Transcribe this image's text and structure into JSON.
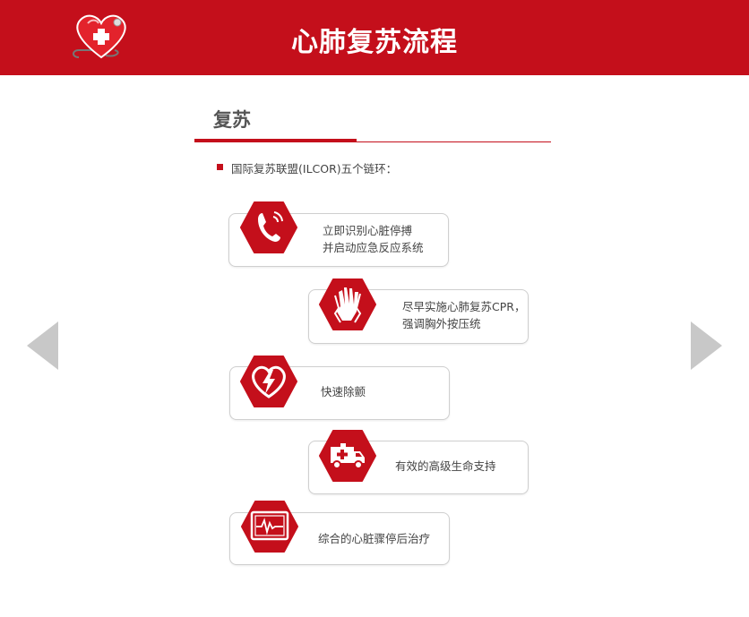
{
  "header": {
    "title": "心肺复苏流程"
  },
  "section": {
    "title": "复苏",
    "intro": "国际复苏联盟(ILCOR)五个链环："
  },
  "steps": [
    {
      "icon": "phone-icon",
      "line1": "立即识别心脏停搏",
      "line2": "并启动应急反应系统"
    },
    {
      "icon": "hands-icon",
      "line1": "尽早实施心肺复苏CPR，",
      "line2": "强调胸外按压统"
    },
    {
      "icon": "defibrillator-heart-icon",
      "line1": "快速除颤",
      "line2": ""
    },
    {
      "icon": "ambulance-icon",
      "line1": "有效的高级生命支持",
      "line2": ""
    },
    {
      "icon": "heart-monitor-icon",
      "line1": "综合的心脏骤停后治疗",
      "line2": ""
    }
  ],
  "colors": {
    "accent": "#c40f1b",
    "nav_arrow": "#c8c8c8",
    "border": "#cfcfcf",
    "text": "#444444"
  }
}
